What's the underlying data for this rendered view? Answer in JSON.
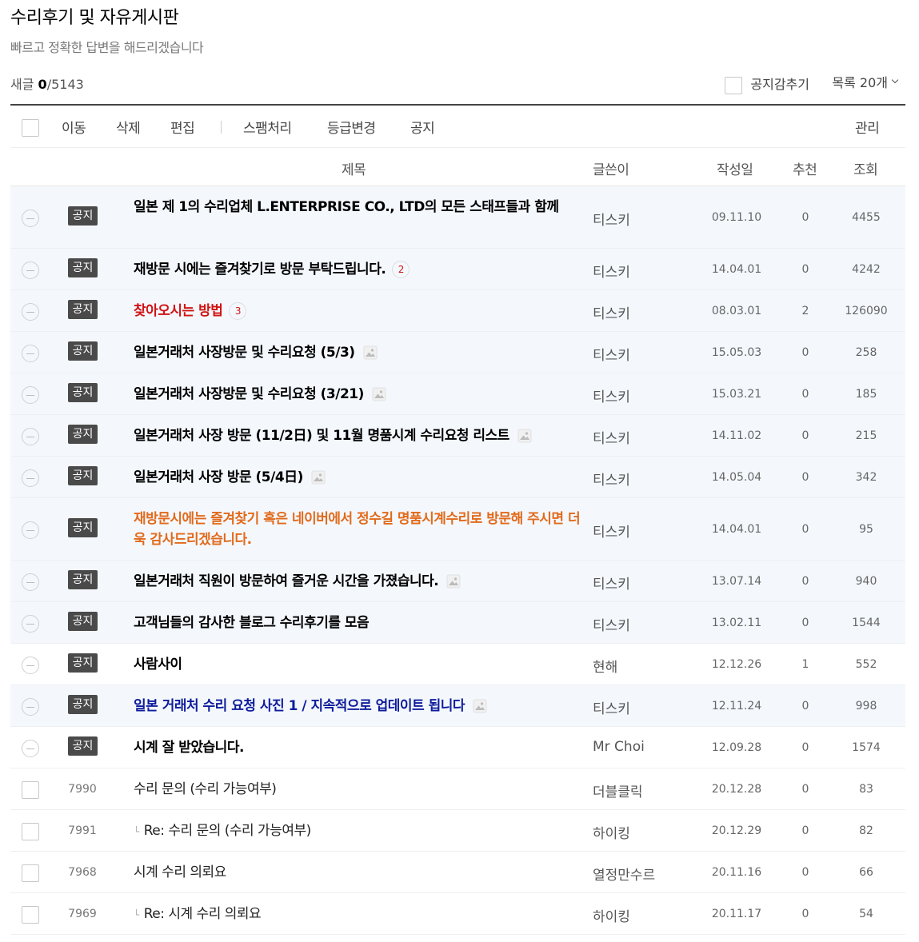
{
  "board": {
    "title": "수리후기 및 자유게시판",
    "description": "빠르고 정확한 답변을 해드리겠습니다"
  },
  "counts": {
    "new_label": "새글",
    "new_count": "0",
    "total": "/5143"
  },
  "options": {
    "hide_notice_label": "공지감추기",
    "list_size_label": "목록 20개"
  },
  "toolbar": {
    "move": "이동",
    "delete": "삭제",
    "edit": "편집",
    "spam": "스팸처리",
    "grade_change": "등급변경",
    "notice": "공지",
    "manage": "관리"
  },
  "columns": {
    "title": "제목",
    "author": "글쓴이",
    "date": "작성일",
    "likes": "추천",
    "views": "조회"
  },
  "notice_badge": "공지",
  "posts": [
    {
      "type": "notice",
      "title": "일본 제 1의 수리업체 L.ENTERPRISE CO., LTD의 모든 스태프들과 함께",
      "style": "bold",
      "author": "티스키",
      "date": "09.11.10",
      "likes": "0",
      "views": "4455",
      "comments": "",
      "image": false
    },
    {
      "type": "notice",
      "title": "재방문 시에는 즐겨찾기로 방문 부탁드립니다.",
      "style": "bold",
      "author": "티스키",
      "date": "14.04.01",
      "likes": "0",
      "views": "4242",
      "comments": "2",
      "image": false
    },
    {
      "type": "notice",
      "title": "찾아오시는 방법",
      "style": "red",
      "author": "티스키",
      "date": "08.03.01",
      "likes": "2",
      "views": "126090",
      "comments": "3",
      "image": false
    },
    {
      "type": "notice",
      "title": "일본거래처 사장방문 및 수리요청 (5/3)",
      "style": "bold",
      "author": "티스키",
      "date": "15.05.03",
      "likes": "0",
      "views": "258",
      "comments": "",
      "image": true
    },
    {
      "type": "notice",
      "title": "일본거래처 사장방문 및 수리요청 (3/21)",
      "style": "bold",
      "author": "티스키",
      "date": "15.03.21",
      "likes": "0",
      "views": "185",
      "comments": "",
      "image": true
    },
    {
      "type": "notice",
      "title": "일본거래처 사장 방문 (11/2日) 및 11월 명품시계 수리요청 리스트",
      "style": "bold",
      "author": "티스키",
      "date": "14.11.02",
      "likes": "0",
      "views": "215",
      "comments": "",
      "image": true
    },
    {
      "type": "notice",
      "title": "일본거래처 사장 방문 (5/4日)",
      "style": "bold",
      "author": "티스키",
      "date": "14.05.04",
      "likes": "0",
      "views": "342",
      "comments": "",
      "image": true
    },
    {
      "type": "notice",
      "title": "재방문시에는 즐겨찾기 혹은 네이버에서 정수길 명품시계수리로 방문해 주시면 더욱 감사드리겠습니다.",
      "style": "orange",
      "author": "티스키",
      "date": "14.04.01",
      "likes": "0",
      "views": "95",
      "comments": "",
      "image": false
    },
    {
      "type": "notice",
      "title": "일본거래처 직원이 방문하여 즐거운 시간을 가졌습니다.",
      "style": "bold",
      "author": "티스키",
      "date": "13.07.14",
      "likes": "0",
      "views": "940",
      "comments": "",
      "image": true
    },
    {
      "type": "notice",
      "title": "고객님들의 감사한 블로그 수리후기를 모음",
      "style": "bold",
      "author": "티스키",
      "date": "13.02.11",
      "likes": "0",
      "views": "1544",
      "comments": "",
      "image": false
    },
    {
      "type": "notice",
      "title": "사람사이",
      "style": "bold",
      "author": "현해",
      "date": "12.12.26",
      "likes": "1",
      "views": "552",
      "comments": "",
      "image": false
    },
    {
      "type": "notice",
      "title": "일본 거래처 수리 요청 사진 1 / 지속적으로 업데이트 됩니다",
      "style": "blue",
      "author": "티스키",
      "date": "12.11.24",
      "likes": "0",
      "views": "998",
      "comments": "",
      "image": true
    },
    {
      "type": "notice",
      "title": "시계 잘 받았습니다.",
      "style": "bold",
      "author": "Mr Choi",
      "date": "12.09.28",
      "likes": "0",
      "views": "1574",
      "comments": "",
      "image": false
    },
    {
      "type": "post",
      "num": "7990",
      "title": "수리 문의 (수리 가능여부)",
      "style": "normal",
      "reply": false,
      "author": "더블클릭",
      "date": "20.12.28",
      "likes": "0",
      "views": "83",
      "comments": "",
      "image": false
    },
    {
      "type": "post",
      "num": "7991",
      "title": "Re: 수리 문의 (수리 가능여부)",
      "style": "normal",
      "reply": true,
      "author": "하이킹",
      "date": "20.12.29",
      "likes": "0",
      "views": "82",
      "comments": "",
      "image": false
    },
    {
      "type": "post",
      "num": "7968",
      "title": "시계 수리 의뢰요",
      "style": "normal",
      "reply": false,
      "author": "열정만수르",
      "date": "20.11.16",
      "likes": "0",
      "views": "66",
      "comments": "",
      "image": false
    },
    {
      "type": "post",
      "num": "7969",
      "title": "Re: 시계 수리 의뢰요",
      "style": "normal",
      "reply": true,
      "author": "하이킹",
      "date": "20.11.17",
      "likes": "0",
      "views": "54",
      "comments": "",
      "image": false
    }
  ]
}
